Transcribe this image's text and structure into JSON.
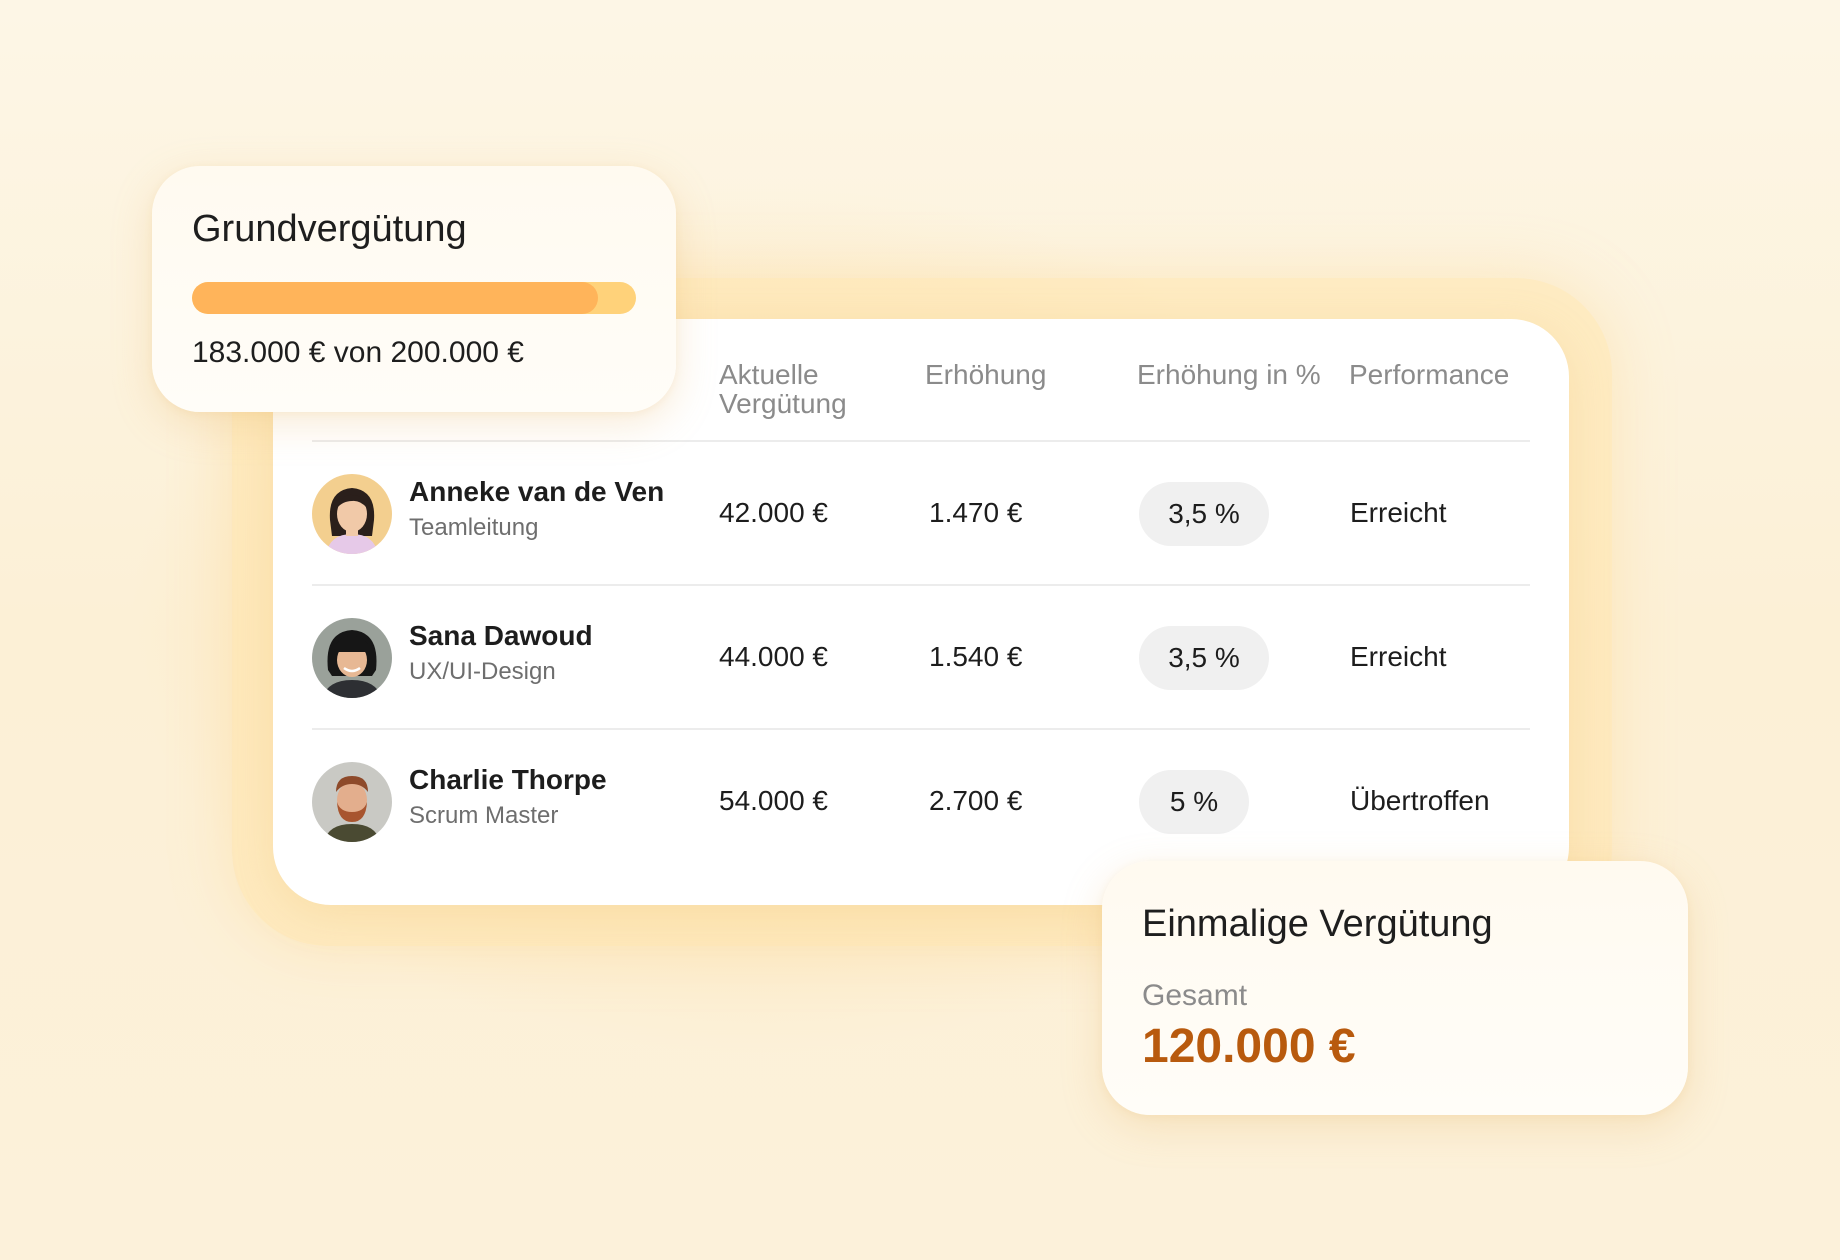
{
  "base_pay_card": {
    "title": "Grundvergütung",
    "progress_fraction": 0.915,
    "summary": "183.000 € von 200.000 €",
    "track_color": "#ffd27a",
    "fill_color": "#ffb45a"
  },
  "table": {
    "headers": {
      "current_pay": "Aktuelle Vergütung",
      "increase": "Erhöhung",
      "increase_pct": "Erhöhung in %",
      "performance": "Performance"
    },
    "rows": [
      {
        "name": "Anneke van de Ven",
        "role": "Teamleitung",
        "current_pay": "42.000 €",
        "increase": "1.470 €",
        "increase_pct": "3,5 %",
        "performance": "Erreicht",
        "avatar": "avatar-woman-dark-hair"
      },
      {
        "name": "Sana Dawoud",
        "role": "UX/UI-Design",
        "current_pay": "44.000 €",
        "increase": "1.540 €",
        "increase_pct": "3,5 %",
        "performance": "Erreicht",
        "avatar": "avatar-woman-bangs"
      },
      {
        "name": "Charlie Thorpe",
        "role": "Scrum Master",
        "current_pay": "54.000 €",
        "increase": "2.700 €",
        "increase_pct": "5 %",
        "performance": "Übertroffen",
        "avatar": "avatar-man-beard"
      }
    ]
  },
  "one_time_card": {
    "title": "Einmalige Vergütung",
    "label": "Gesamt",
    "value": "120.000 €",
    "value_color": "#b85a0e"
  }
}
